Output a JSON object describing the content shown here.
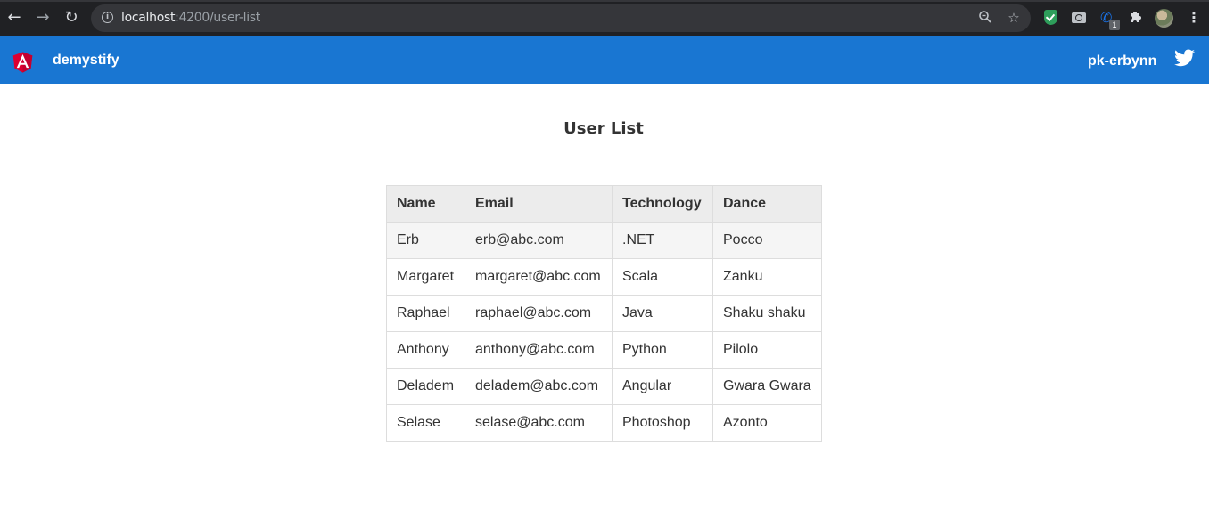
{
  "browser": {
    "url_host": "localhost",
    "url_rest": ":4200/user-list",
    "extension_badge": "1"
  },
  "header": {
    "brand": "demystify",
    "user": "pk-erbynn"
  },
  "main": {
    "title": "User List",
    "table": {
      "columns": [
        "Name",
        "Email",
        "Technology",
        "Dance"
      ],
      "rows": [
        [
          "Erb",
          "erb@abc.com",
          ".NET",
          "Pocco"
        ],
        [
          "Margaret",
          "margaret@abc.com",
          "Scala",
          "Zanku"
        ],
        [
          "Raphael",
          "raphael@abc.com",
          "Java",
          "Shaku shaku"
        ],
        [
          "Anthony",
          "anthony@abc.com",
          "Python",
          "Pilolo"
        ],
        [
          "Deladem",
          "deladem@abc.com",
          "Angular",
          "Gwara Gwara"
        ],
        [
          "Selase",
          "selase@abc.com",
          "Photoshop",
          "Azonto"
        ]
      ]
    }
  },
  "colors": {
    "header_bg": "#1976d2",
    "angular_red": "#dd0031",
    "chrome_bg": "#202124"
  },
  "icons": [
    "back-arrow-icon",
    "forward-arrow-icon",
    "reload-icon",
    "info-icon",
    "zoom-icon",
    "star-icon",
    "shield-extension-icon",
    "camera-extension-icon",
    "phone-extension-icon",
    "puzzle-extensions-icon",
    "profile-avatar",
    "kebab-menu-icon",
    "angular-logo",
    "twitter-icon"
  ]
}
